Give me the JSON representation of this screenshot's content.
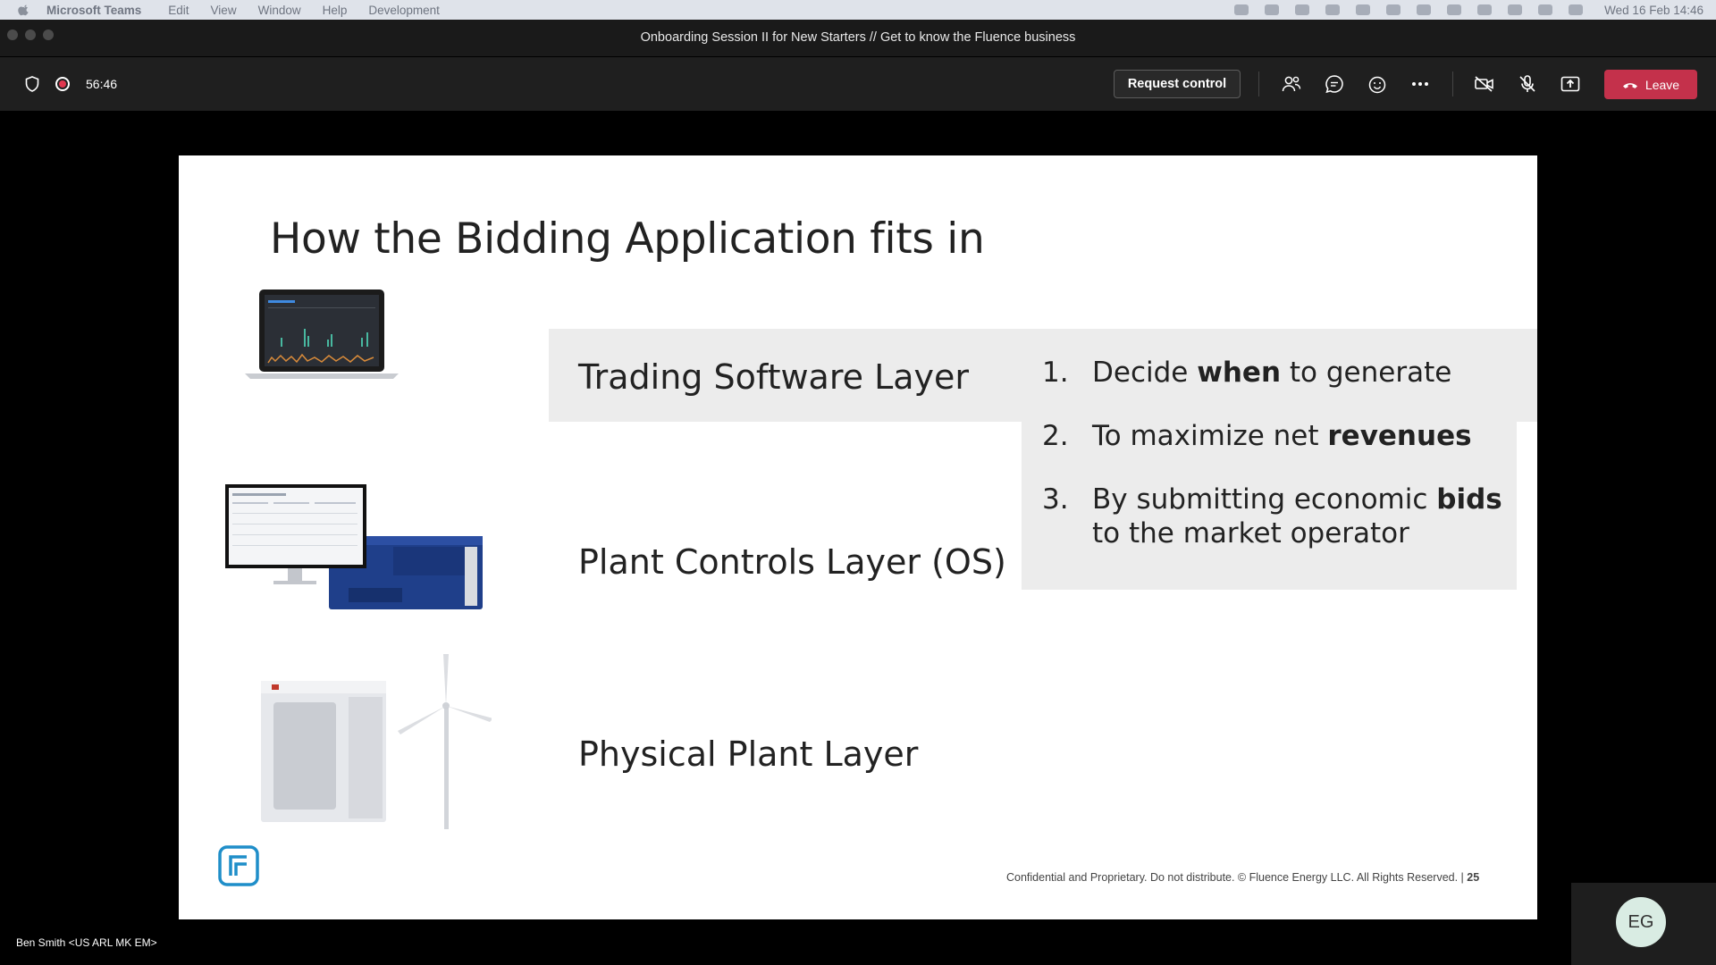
{
  "menubar": {
    "app": "Microsoft Teams",
    "items": [
      "Edit",
      "View",
      "Window",
      "Help",
      "Development"
    ],
    "clock": "Wed 16 Feb  14:46"
  },
  "window": {
    "title": "Onboarding Session II for New Starters // Get to know the Fluence business"
  },
  "toolbar": {
    "timer": "56:46",
    "request_control": "Request control",
    "leave": "Leave",
    "colors": {
      "leave_bg": "#c4314b",
      "recording": "#e0374f"
    }
  },
  "slide": {
    "heading": "How the Bidding Application fits in",
    "layers": [
      "Trading Software Layer",
      "Plant Controls Layer (OS)",
      "Physical Plant Layer"
    ],
    "steps": [
      {
        "num": "1.",
        "pre": "Decide ",
        "bold": "when",
        "post": " to generate",
        "line2": ""
      },
      {
        "num": "2.",
        "pre": "To maximize net ",
        "bold": "revenues",
        "post": "",
        "line2": ""
      },
      {
        "num": "3.",
        "pre": "By submitting economic ",
        "bold": "bids",
        "post": "",
        "line2": "to the market operator"
      }
    ],
    "footer": "Confidential and Proprietary. Do not distribute. © Fluence Energy LLC. All Rights Reserved.  |",
    "page_number": "25"
  },
  "presenter": "Ben Smith <US ARL MK EM>",
  "self_avatar": "EG"
}
